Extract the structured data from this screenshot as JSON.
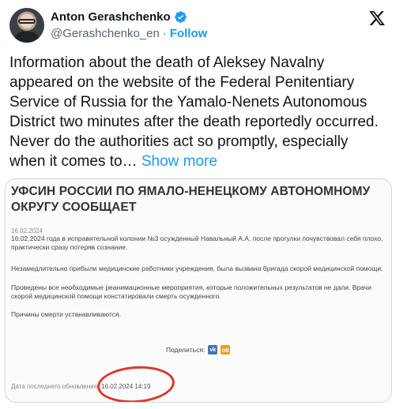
{
  "header": {
    "name": "Anton Gerashchenko",
    "handle": "@Gerashchenko_en",
    "separator": "·",
    "follow_label": "Follow"
  },
  "tweet": {
    "text": "Information about the death of Aleksey Navalny appeared on the website of the Federal Penitentiary Service of Russia for the Yamalo-Nenets Autonomous District two minutes after the death reportedly occurred. Never do the authorities act so promptly, especially when it comes to…",
    "show_more": "Show more"
  },
  "card": {
    "title": "УФСИН РОССИИ ПО ЯМАЛО-НЕНЕЦКОМУ АВТОНОМНОМУ ОКРУГУ СООБЩАЕТ",
    "pub_date": "16.02.2024",
    "p1": "16.02.2024 года в исправительной колонии №3 осужденный Навальный А.А. после прогулки почувствовал себя плохо, практически сразу потеряв сознание.",
    "p2": "Незамедлительно прибыли медицинские работники учреждения, была вызвана бригада скорой медицинской помощи.",
    "p3": "Проведены все необходимые реанимационные мероприятия, которые положительных результатов не дали. Врачи скорой медицинской помощи констатировали смерть осужденного.",
    "p4": "Причины смерти устанавливаются.",
    "share_label": "Поделиться:",
    "vk_label": "vk",
    "ok_label": "ok",
    "updated_label": "Дата последнего обновления:",
    "updated_value": "16.02.2024 14:19"
  },
  "colors": {
    "accent": "#1d9bf0",
    "circle": "#e0342b"
  }
}
